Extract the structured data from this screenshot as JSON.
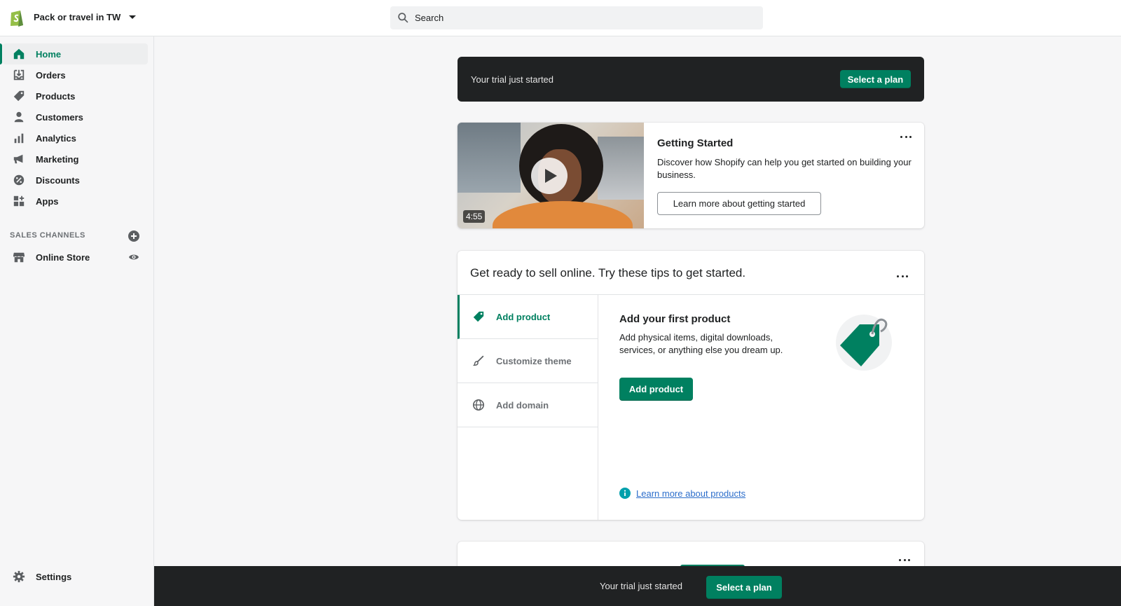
{
  "store": {
    "name": "Pack or travel in TW"
  },
  "search": {
    "placeholder": "Search"
  },
  "sidebar": {
    "items": [
      {
        "label": "Home",
        "icon": "home-icon",
        "active": true
      },
      {
        "label": "Orders",
        "icon": "orders-icon"
      },
      {
        "label": "Products",
        "icon": "tag-icon"
      },
      {
        "label": "Customers",
        "icon": "person-icon"
      },
      {
        "label": "Analytics",
        "icon": "bar-chart-icon"
      },
      {
        "label": "Marketing",
        "icon": "megaphone-icon"
      },
      {
        "label": "Discounts",
        "icon": "discount-icon"
      },
      {
        "label": "Apps",
        "icon": "apps-icon"
      }
    ],
    "sales_channels_title": "SALES CHANNELS",
    "channels": [
      {
        "label": "Online Store",
        "icon": "store-icon"
      }
    ],
    "settings_label": "Settings"
  },
  "trial_banner": {
    "text": "Your trial just started",
    "button": "Select a plan"
  },
  "video_card": {
    "duration": "4:55",
    "title": "Getting Started",
    "description": "Discover how Shopify can help you get started on building your business.",
    "button": "Learn more about getting started"
  },
  "tips_card": {
    "heading": "Get ready to sell online. Try these tips to get started.",
    "tabs": [
      {
        "label": "Add product",
        "icon": "tag-icon",
        "active": true
      },
      {
        "label": "Customize theme",
        "icon": "brush-icon"
      },
      {
        "label": "Add domain",
        "icon": "globe-icon"
      }
    ],
    "panel": {
      "title": "Add your first product",
      "description": "Add physical items, digital downloads, services, or anything else you dream up.",
      "button": "Add product",
      "link": "Learn more about products"
    }
  },
  "bottom_bar": {
    "text": "Your trial just started",
    "button": "Select a plan"
  },
  "colors": {
    "accent": "#008060",
    "dark": "#202223",
    "link": "#2c6ecb",
    "sidebar_bg": "#f6f6f7"
  }
}
